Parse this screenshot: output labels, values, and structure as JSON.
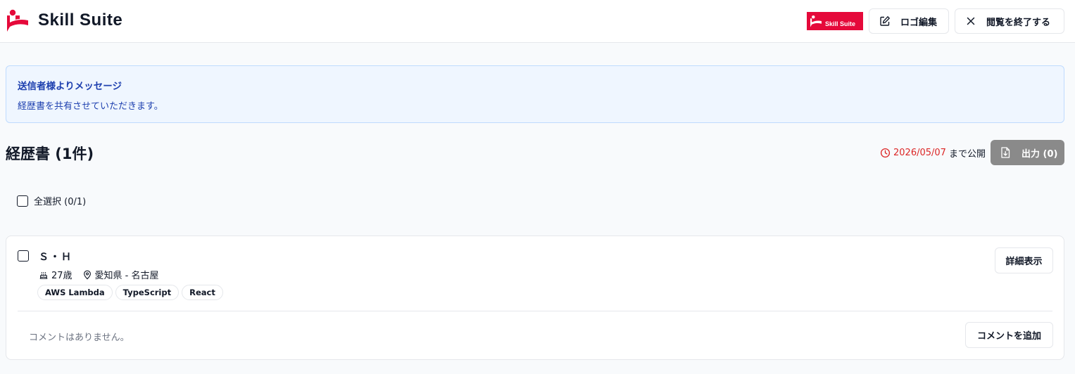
{
  "brand": {
    "name": "Skill Suite",
    "mini_logo_text": "Skill Suite",
    "color": "#e5093a"
  },
  "header": {
    "logo_edit_label": "ロゴ編集",
    "logo_edit_icon": "edit-icon",
    "close_label": "閲覧を終了する",
    "close_icon": "close-icon"
  },
  "message": {
    "title": "送信者様よりメッセージ",
    "body": "経歴書を共有させていただきます。"
  },
  "section": {
    "title": "経歴書 (1件)",
    "expiry_date": "2026/05/07",
    "expiry_suffix": "まで公開",
    "export_label": "出力 (0)",
    "export_icon": "file-download-icon"
  },
  "select_all": {
    "label": "全選択 (0/1)",
    "checked": false
  },
  "card": {
    "name": "Ｓ・Ｈ",
    "age": "27歳",
    "location": "愛知県 - 名古屋",
    "tags": [
      "AWS Lambda",
      "TypeScript",
      "React"
    ],
    "detail_label": "詳細表示",
    "no_comment_text": "コメントはありません。",
    "add_comment_label": "コメントを追加",
    "checked": false
  },
  "colors": {
    "accent_red": "#dc2626",
    "message_blue": "#1e40af",
    "message_bg": "#eff6ff",
    "export_disabled": "#8a8a8a"
  }
}
